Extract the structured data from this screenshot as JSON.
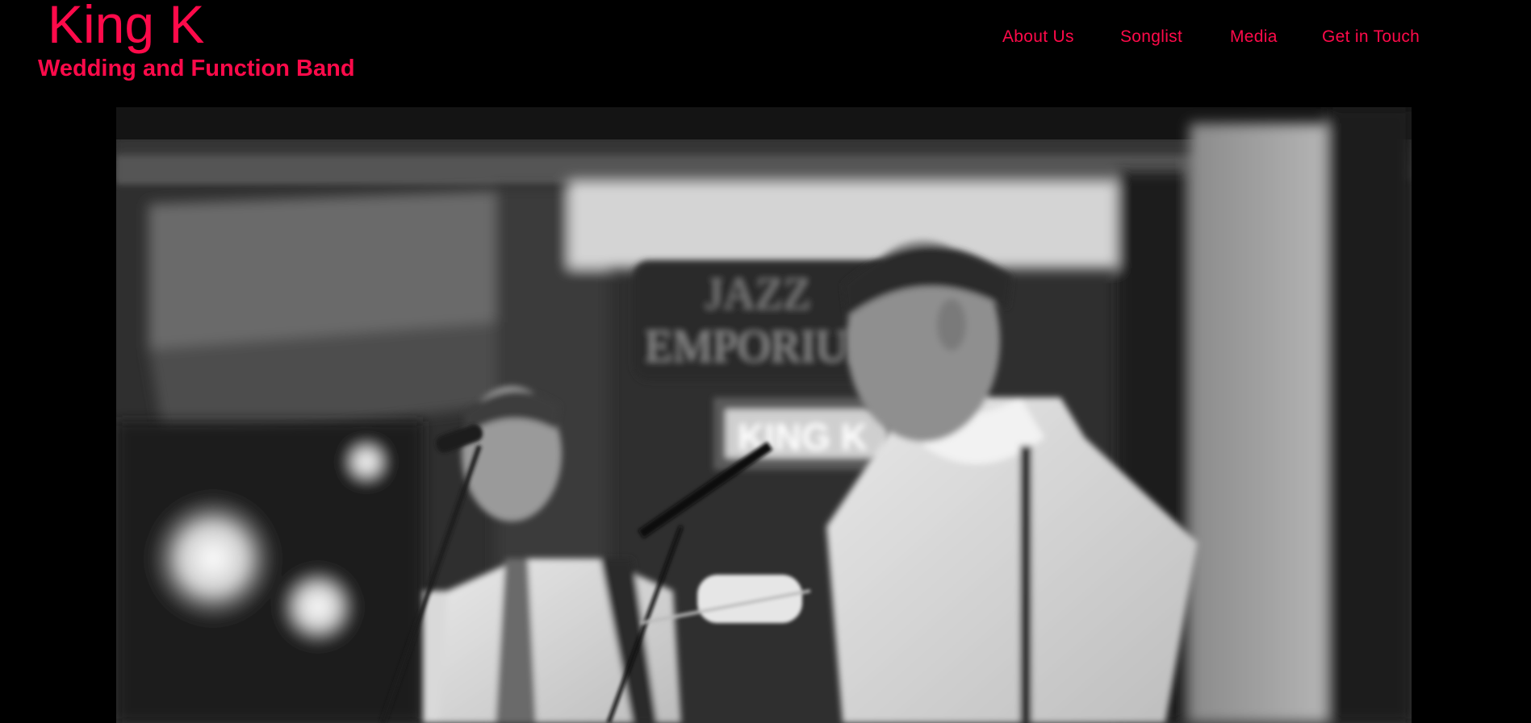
{
  "brand": {
    "title": "King K",
    "subtitle": "Wedding and Function Band"
  },
  "nav": {
    "items": [
      {
        "label": "About Us"
      },
      {
        "label": "Songlist"
      },
      {
        "label": "Media"
      },
      {
        "label": "Get in Touch"
      }
    ]
  },
  "hero": {
    "sign_top": "JAZZ",
    "sign_middle": "EMPORIUM",
    "sign_banner": "KING K"
  },
  "colors": {
    "accent": "#ff0a4a",
    "background": "#000000"
  }
}
